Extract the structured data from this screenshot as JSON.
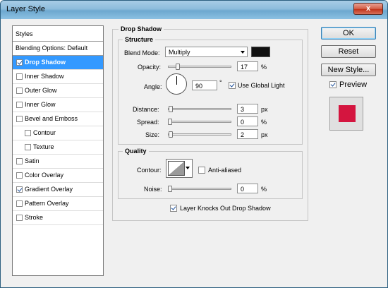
{
  "window": {
    "title": "Layer Style",
    "close_glyph": "x"
  },
  "styles": {
    "header": "Styles",
    "blending_options": "Blending Options: Default",
    "items": [
      {
        "label": "Drop Shadow",
        "checked": true,
        "selected": true,
        "sub": false
      },
      {
        "label": "Inner Shadow",
        "checked": false,
        "selected": false,
        "sub": false
      },
      {
        "label": "Outer Glow",
        "checked": false,
        "selected": false,
        "sub": false
      },
      {
        "label": "Inner Glow",
        "checked": false,
        "selected": false,
        "sub": false
      },
      {
        "label": "Bevel and Emboss",
        "checked": false,
        "selected": false,
        "sub": false
      },
      {
        "label": "Contour",
        "checked": false,
        "selected": false,
        "sub": true
      },
      {
        "label": "Texture",
        "checked": false,
        "selected": false,
        "sub": true
      },
      {
        "label": "Satin",
        "checked": false,
        "selected": false,
        "sub": false
      },
      {
        "label": "Color Overlay",
        "checked": false,
        "selected": false,
        "sub": false
      },
      {
        "label": "Gradient Overlay",
        "checked": true,
        "selected": false,
        "sub": false
      },
      {
        "label": "Pattern Overlay",
        "checked": false,
        "selected": false,
        "sub": false
      },
      {
        "label": "Stroke",
        "checked": false,
        "selected": false,
        "sub": false
      }
    ]
  },
  "drop_shadow": {
    "title": "Drop Shadow",
    "structure": {
      "title": "Structure",
      "blend_mode_label": "Blend Mode:",
      "blend_mode_value": "Multiply",
      "shadow_color": "#111111",
      "opacity_label": "Opacity:",
      "opacity_value": "17",
      "percent": "%",
      "angle_label": "Angle:",
      "angle_value": "90",
      "degree": "°",
      "global_light_label": "Use Global Light",
      "global_light_checked": true,
      "distance_label": "Distance:",
      "distance_value": "3",
      "spread_label": "Spread:",
      "spread_value": "0",
      "size_label": "Size:",
      "size_value": "2",
      "px": "px"
    },
    "quality": {
      "title": "Quality",
      "contour_label": "Contour:",
      "anti_aliased_label": "Anti-aliased",
      "anti_aliased_checked": false,
      "noise_label": "Noise:",
      "noise_value": "0",
      "percent": "%"
    },
    "knockout_label": "Layer Knocks Out Drop Shadow",
    "knockout_checked": true
  },
  "buttons": {
    "ok": "OK",
    "reset": "Reset",
    "new_style": "New Style...",
    "preview_label": "Preview",
    "preview_checked": true
  },
  "colors": {
    "selection": "#3399ff",
    "preview_swatch": "#d4153f"
  }
}
